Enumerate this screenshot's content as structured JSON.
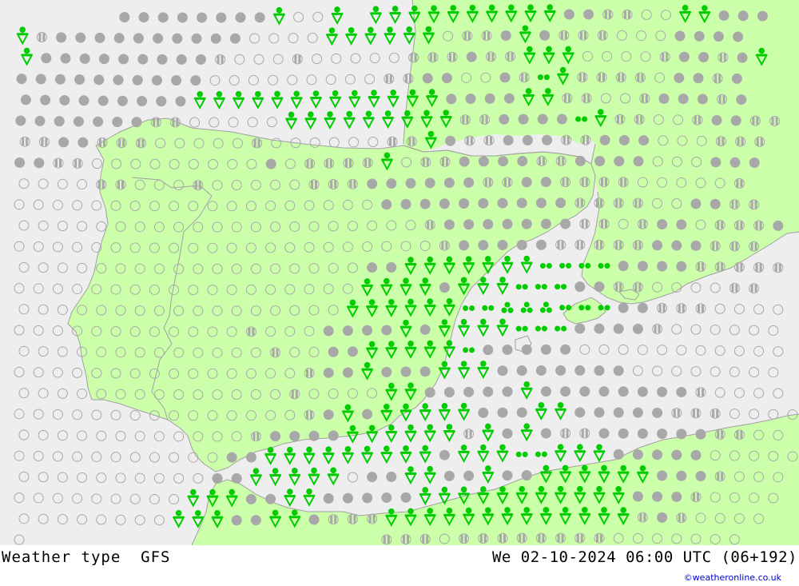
{
  "header": {
    "product": "Weather type",
    "model": "GFS",
    "valid_time": "We 02-10-2024 06:00 UTC (06+192)",
    "credit": "©weatheronline.co.uk"
  },
  "colors": {
    "sea": "#eeeeee",
    "land": "#ccffaa",
    "coast": "#a0a0a0",
    "cloud_symbol": "#a8a8a8",
    "precip_symbol": "#00cc00"
  },
  "legend": {
    "o": "clear",
    "h": "partly-cloudy",
    "f": "overcast",
    "s": "showers",
    "d": "drizzle",
    "t": "rain",
    ".": "none"
  },
  "grid_rows": [
    ".....ffffffffsoos.ssssssssssffhhoossfff",
    "shffffffffffoooossssssohhfsfhhhoooffff",
    "sfffffffffhooohooooohhhfhhsssoooohffhfs",
    "ffffffffffooooooooohhffoofhdshhhhoffhf",
    "fffffffffsssssssssssssffffsshhoohfffhf",
    "fffffffhhooooossssssssshhffffdshhoohffhh",
    "hhffhhhooooohoooooohhsfhhfffhhfffooohhh",
    "ffhhooooooooofohhhhsohhffffhhffffooofff",
    "oooohhooohooooohhhffffffhhffhhhhoooooh",
    "oooooooooooooooooooffffffffffhhhhooffhh",
    "ooooooooooooooooooooohfffffffhhohffohhhf",
    "oooooooooooooooooooooohfffffhhhhhfffhhh",
    "ooooooooooooooooooffsssssssddddffffhhhhhh",
    "oooooooooooooooooossssfsssdddffhhoooohh",
    "ooooooooooooooooossssssddtttdddffhhhoooo",
    "oooooooooooohoooffffsfssssdddffffhoooooo",
    "ooooooooooooohooffsssssdfffffooooooooooo",
    "ooooooooooooooohffsfffsssfffffffoooooooo",
    "oooooooooooooohoooossfffffsffffffffhooooo",
    "ooooooooooooooohfsfsssssfffssfffffhhhoooo",
    "oooooooooooohffffsssssshsfsfhhffffffhhooo",
    "oooooooooooffsssssssssfsssddsssfffffooooo",
    "ooooooooooffsssssoffssffsffssssssfffhoooo",
    "ooooooooosssffssfffffsssssssssssfffhoooo",
    "oooooooosssffssfhhhssssssssssssshfhoooo",
    "ooooooosssdssssfhhhhhhohhhhhhhhoooooooo"
  ]
}
